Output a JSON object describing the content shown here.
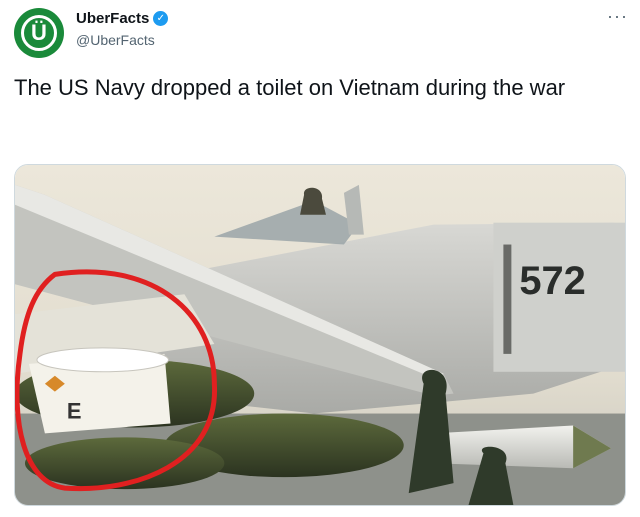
{
  "account": {
    "display_name": "UberFacts",
    "handle": "@UberFacts",
    "avatar_glyph": "Ü",
    "verified_glyph": "✓",
    "avatar_color": "#1a8a3a",
    "verified_color": "#1d9bf0"
  },
  "more_menu": {
    "glyph": "···"
  },
  "tweet": {
    "text": "The US Navy dropped a toilet on Vietnam during the war"
  },
  "media": {
    "aircraft_number": "572",
    "toilet_marking": "E",
    "annotation_color": "#e02020"
  }
}
